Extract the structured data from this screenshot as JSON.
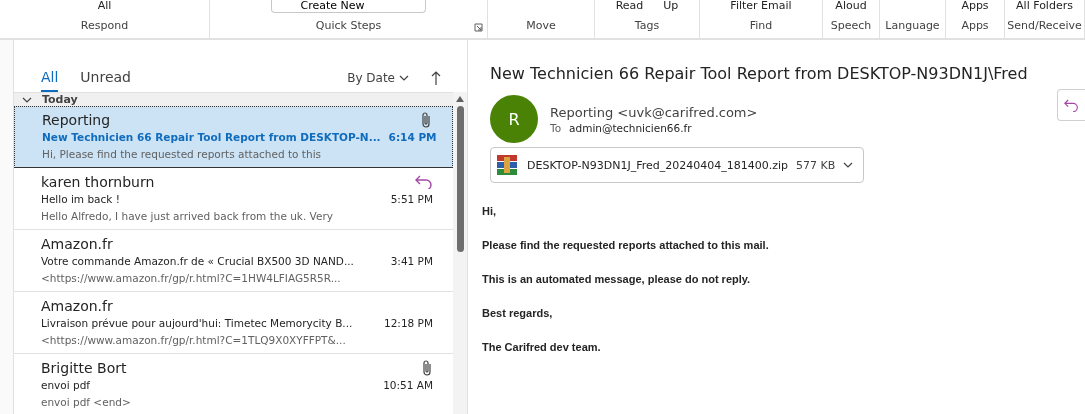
{
  "ribbon": {
    "groups": [
      {
        "label": "Respond",
        "items": [
          "All"
        ]
      },
      {
        "label": "Quick Steps",
        "items": [
          "Create New"
        ],
        "launcher": true
      },
      {
        "label": "Move"
      },
      {
        "label": "Tags",
        "items": [
          "Read",
          "Up"
        ]
      },
      {
        "label": "Find",
        "items": [
          "Filter Email"
        ]
      },
      {
        "label": "Speech",
        "items": [
          "Aloud"
        ]
      },
      {
        "label": "Language"
      },
      {
        "label": "Apps",
        "items": [
          "Apps"
        ]
      },
      {
        "label": "Send/Receive",
        "items": [
          "All Folders"
        ]
      }
    ]
  },
  "message_list": {
    "tabs": [
      {
        "label": "All",
        "selected": true
      },
      {
        "label": "Unread",
        "selected": false
      }
    ],
    "sort": "By Date",
    "group": {
      "label": "Today",
      "expanded": true
    },
    "messages": [
      {
        "sender": "Reporting",
        "subject": "New Technicien 66 Repair Tool Report from DESKTOP-N...",
        "preview": "Hi,  Please find the requested reports attached to this",
        "time": "6:14 PM",
        "selected": true,
        "unread": true,
        "attachment": true,
        "replied": false
      },
      {
        "sender": "karen thornburn",
        "subject": "Hello im back !",
        "preview": "Hello Alfredo,  I have just arrived back from the uk. Very",
        "time": "5:51 PM",
        "selected": false,
        "unread": false,
        "attachment": false,
        "replied": true
      },
      {
        "sender": "Amazon.fr",
        "subject": "Votre commande Amazon.fr de « Crucial BX500 3D NAND...",
        "preview": "<https://www.amazon.fr/gp/r.html?C=1HW4LFIAG5R5R...",
        "time": "3:41 PM",
        "selected": false,
        "unread": false,
        "attachment": false,
        "replied": false
      },
      {
        "sender": "Amazon.fr",
        "subject": "Livraison prévue pour aujourd'hui: Timetec Memorycity B...",
        "preview": "<https://www.amazon.fr/gp/r.html?C=1TLQ9X0XYFFPT&...",
        "time": "12:18 PM",
        "selected": false,
        "unread": false,
        "attachment": false,
        "replied": false
      },
      {
        "sender": "Brigitte Bort",
        "subject": "envoi pdf",
        "preview": "envoi pdf <end>",
        "time": "10:51 AM",
        "selected": false,
        "unread": false,
        "attachment": true,
        "replied": false
      }
    ]
  },
  "reading_pane": {
    "subject": "New Technicien 66 Repair Tool Report from DESKTOP-N93DN1J\\Fred",
    "avatar": {
      "initial": "R",
      "color": "#498205"
    },
    "from": "Reporting <uvk@carifred.com>",
    "to_label": "To",
    "to": "admin@technicien66.fr",
    "attachment": {
      "name": "DESKTOP-N93DN1J_Fred_20240404_181400.zip",
      "size": "577 KB"
    },
    "body": [
      "Hi,",
      "Please find the requested reports attached to this mail.",
      "This is an automated message, please do not reply.",
      "Best regards,",
      "The Carifred dev team."
    ]
  }
}
